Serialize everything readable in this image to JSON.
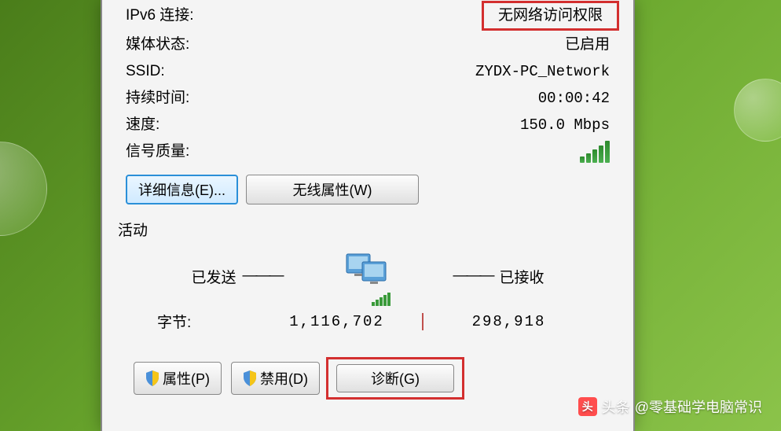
{
  "info": {
    "ipv6_label": "IPv6 连接:",
    "ipv6_value": "无网络访问权限",
    "media_label": "媒体状态:",
    "media_value": "已启用",
    "ssid_label": "SSID:",
    "ssid_value": "ZYDX-PC_Network",
    "duration_label": "持续时间:",
    "duration_value": "00:00:42",
    "speed_label": "速度:",
    "speed_value": "150.0 Mbps",
    "signal_label": "信号质量:"
  },
  "buttons": {
    "details": "详细信息(E)...",
    "wireless_props": "无线属性(W)",
    "properties": "属性(P)",
    "disable": "禁用(D)",
    "diagnose": "诊断(G)"
  },
  "activity": {
    "title": "活动",
    "sent_label": "已发送",
    "received_label": "已接收",
    "bytes_label": "字节:",
    "bytes_sent": "1,116,702",
    "bytes_received": "298,918"
  },
  "watermark": {
    "prefix": "头条",
    "text": "@零基础学电脑常识"
  }
}
